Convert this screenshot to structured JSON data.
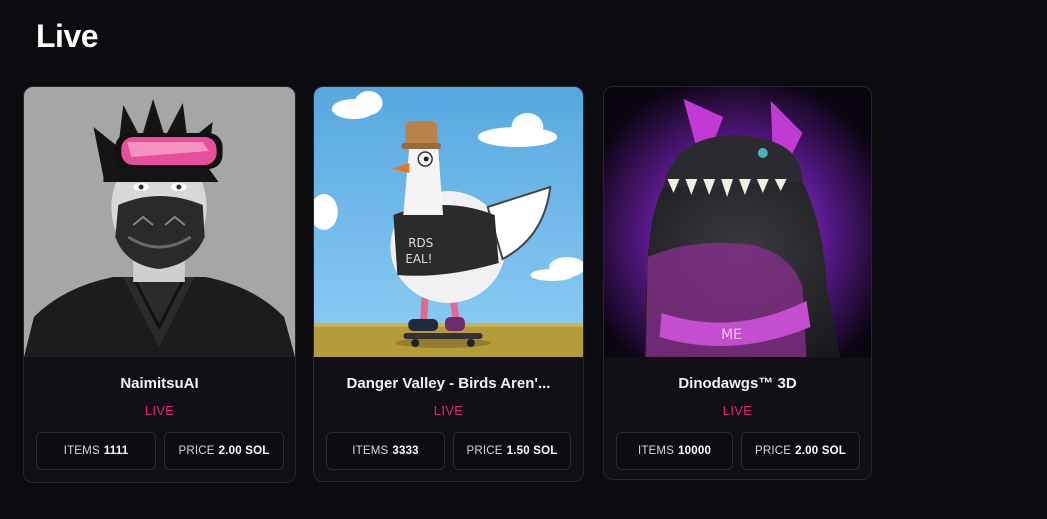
{
  "section": {
    "title": "Live"
  },
  "cards": [
    {
      "name": "NaimitsuAI",
      "status": "LIVE",
      "items_label": "ITEMS",
      "items_value": "1111",
      "price_label": "PRICE",
      "price_value": "2.00 SOL",
      "image_icon": "avatar-masked-ninja"
    },
    {
      "name": "Danger Valley - Birds Aren'...",
      "status": "LIVE",
      "items_label": "ITEMS",
      "items_value": "3333",
      "price_label": "PRICE",
      "price_value": "1.50 SOL",
      "image_icon": "skateboarding-bird"
    },
    {
      "name": "Dinodawgs™ 3D",
      "status": "LIVE",
      "items_label": "ITEMS",
      "items_value": "10000",
      "price_label": "PRICE",
      "price_value": "2.00 SOL",
      "image_icon": "purple-dino"
    }
  ],
  "colors": {
    "background": "#0c0c10",
    "card_background": "#0f0f15",
    "border": "#26262f",
    "live_accent": "#e42575"
  }
}
